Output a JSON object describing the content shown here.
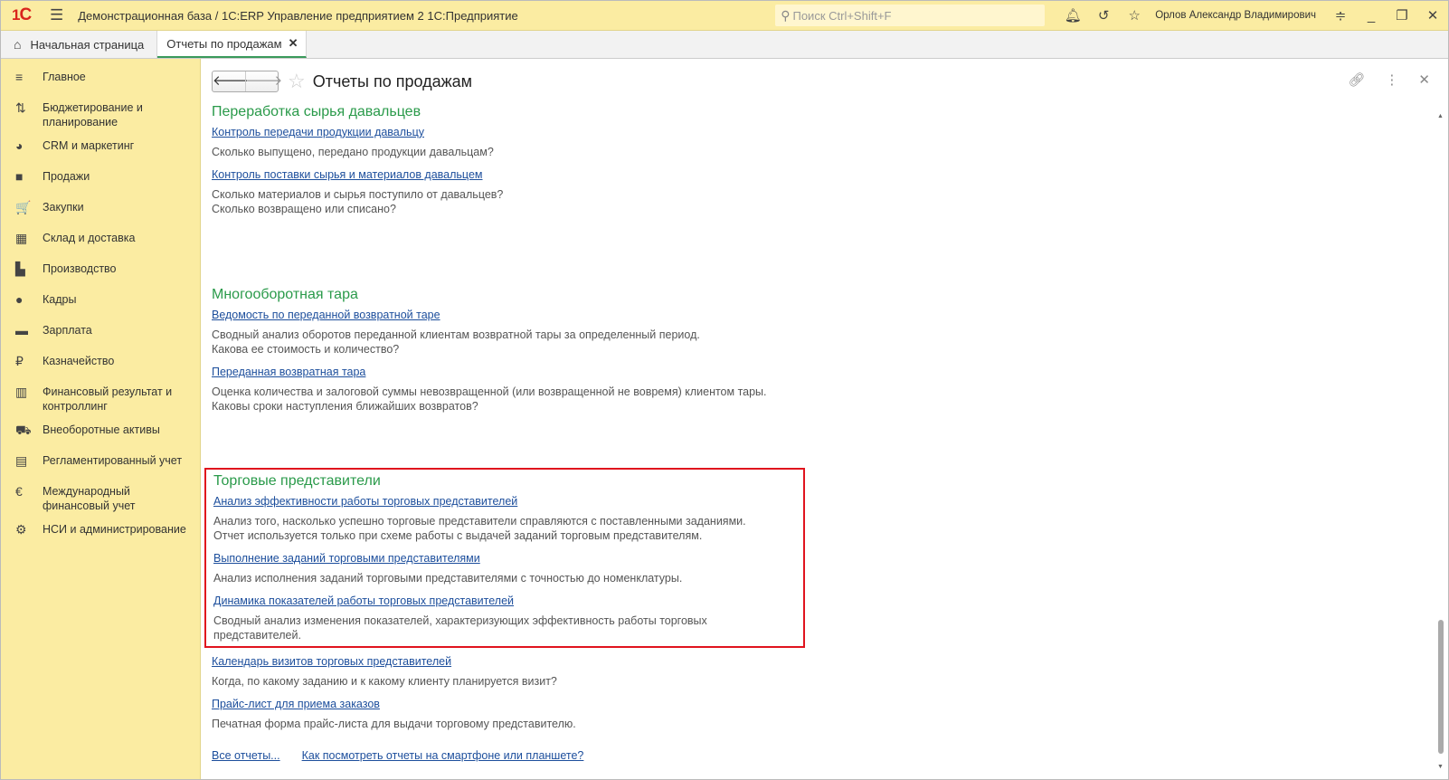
{
  "titlebar": {
    "logo": "1С",
    "title": "Демонстрационная база / 1С:ERP Управление предприятием 2 1С:Предприятие",
    "search_placeholder": "Поиск Ctrl+Shift+F",
    "user": "Орлов Александр Владимирович"
  },
  "tabs": [
    {
      "label": "Начальная страница"
    },
    {
      "label": "Отчеты по продажам"
    }
  ],
  "sidebar": {
    "items": [
      {
        "label": "Главное",
        "icon": "≡"
      },
      {
        "label": "Бюджетирование и планирование",
        "icon": "⇅"
      },
      {
        "label": "CRM и маркетинг",
        "icon": "◕"
      },
      {
        "label": "Продажи",
        "icon": "■"
      },
      {
        "label": "Закупки",
        "icon": "🛒"
      },
      {
        "label": "Склад и доставка",
        "icon": "▦"
      },
      {
        "label": "Производство",
        "icon": "▙"
      },
      {
        "label": "Кадры",
        "icon": "●"
      },
      {
        "label": "Зарплата",
        "icon": "▬"
      },
      {
        "label": "Казначейство",
        "icon": "₽"
      },
      {
        "label": "Финансовый результат и контроллинг",
        "icon": "▥"
      },
      {
        "label": "Внеоборотные активы",
        "icon": "⛟"
      },
      {
        "label": "Регламентированный учет",
        "icon": "▤"
      },
      {
        "label": "Международный финансовый учет",
        "icon": "€"
      },
      {
        "label": "НСИ и администрирование",
        "icon": "⚙"
      }
    ]
  },
  "page": {
    "title": "Отчеты по продажам"
  },
  "sections": [
    {
      "title": "Переработка сырья давальцев",
      "reports": [
        {
          "link": "Контроль передачи продукции давальцу",
          "desc": [
            "Сколько выпущено, передано продукции давальцам?"
          ]
        },
        {
          "link": "Контроль поставки сырья и материалов давальцем",
          "desc": [
            "Сколько материалов и сырья поступило от давальцев?",
            "Сколько возвращено или списано?"
          ]
        }
      ]
    },
    {
      "title": "Многооборотная тара",
      "reports": [
        {
          "link": "Ведомость по переданной возвратной таре",
          "desc": [
            "Сводный анализ оборотов переданной клиентам возвратной тары за определенный период.",
            "Какова ее стоимость и количество?"
          ]
        },
        {
          "link": "Переданная возвратная тара",
          "desc": [
            "Оценка количества и залоговой суммы невозвращенной (или возвращенной не вовремя) клиентом тары.",
            "Каковы сроки наступления ближайших возвратов?"
          ]
        }
      ]
    },
    {
      "title": "Торговые представители",
      "reports": [
        {
          "link": "Анализ эффективности работы торговых представителей",
          "desc": [
            "Анализ того, насколько успешно торговые представители справляются с поставленными заданиями.",
            "Отчет используется только при схеме работы с выдачей заданий торговым представителям."
          ]
        },
        {
          "link": "Выполнение заданий торговыми представителями",
          "desc": [
            "Анализ исполнения заданий торговыми представителями с точностью до номенклатуры."
          ]
        },
        {
          "link": "Динамика показателей работы торговых представителей",
          "desc": [
            "Сводный анализ изменения показателей, характеризующих эффективность работы торговых представителей."
          ]
        },
        {
          "link": "Календарь визитов торговых представителей",
          "desc": [
            "Когда, по какому заданию и к какому клиенту планируется визит?"
          ]
        },
        {
          "link": "Прайс-лист для приема заказов",
          "desc": [
            "Печатная форма прайс-листа для выдачи торговому представителю."
          ]
        }
      ]
    }
  ],
  "footer": {
    "all_reports": "Все отчеты...",
    "mobile": "Как посмотреть отчеты на смартфоне или планшете?"
  }
}
